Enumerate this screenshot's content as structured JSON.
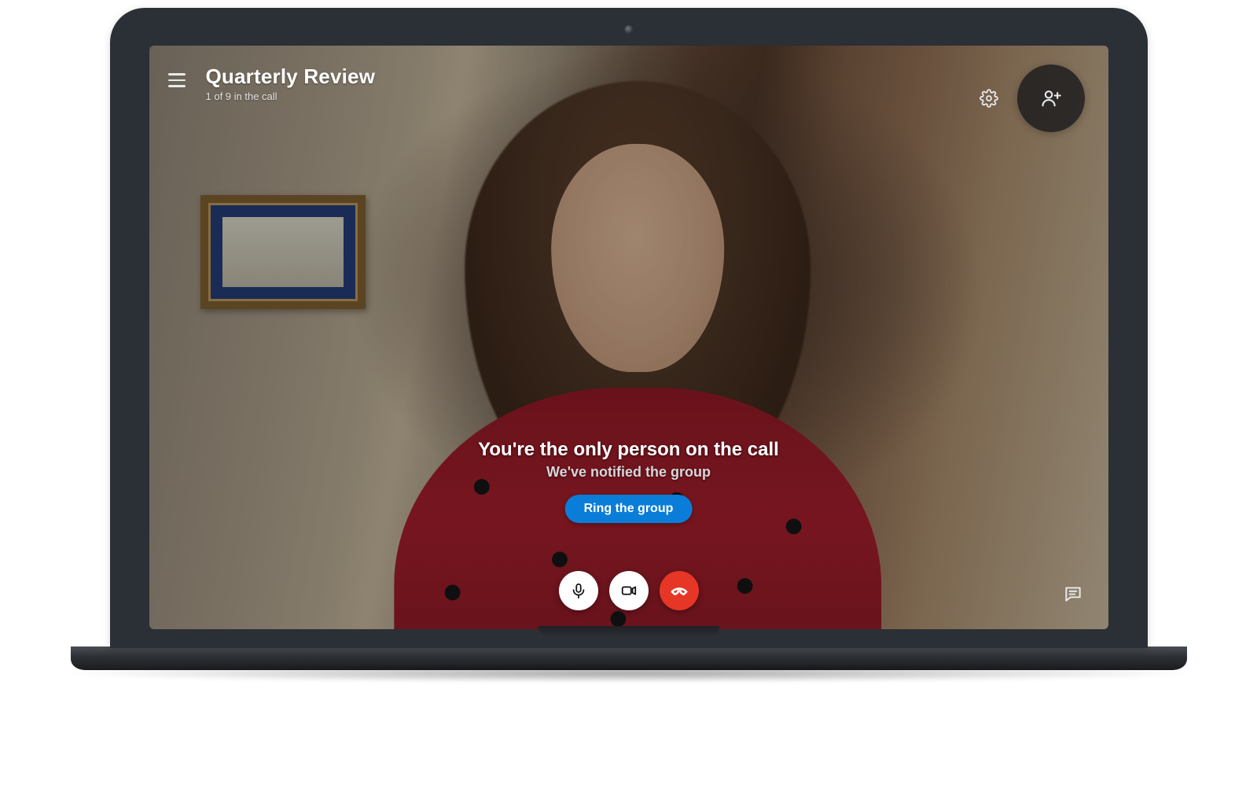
{
  "header": {
    "call_title": "Quarterly Review",
    "participants_status": "1 of 9 in the call"
  },
  "notice": {
    "title": "You're the only person on the call",
    "subtitle": "We've notified the group",
    "ring_button_label": "Ring the group"
  },
  "controls": {
    "mic": "microphone",
    "video": "video",
    "hangup": "hang up"
  },
  "colors": {
    "accent_blue": "#0a7dd8",
    "hangup_red": "#e63626"
  }
}
